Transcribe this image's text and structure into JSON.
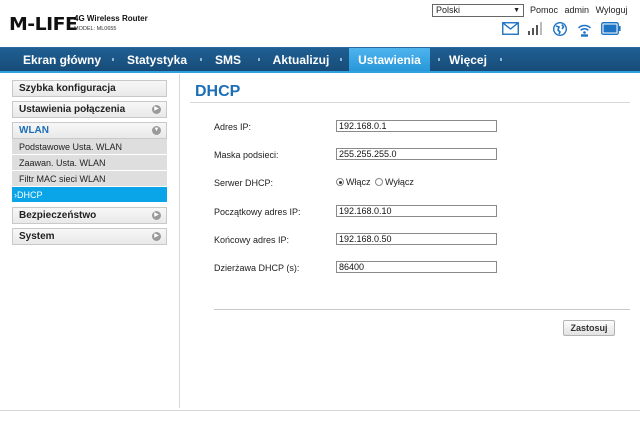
{
  "header": {
    "logo": "M-LIFE",
    "model_title": "4G Wireless Router",
    "model_sub": "MODEL: ML0655",
    "language": "Polski",
    "links": {
      "help": "Pomoc",
      "user": "admin",
      "logout": "Wyloguj"
    },
    "icons": [
      "envelope-icon",
      "signal-bars-icon",
      "globe-icon",
      "wifi-icon",
      "battery-icon"
    ]
  },
  "nav": {
    "items": [
      "Ekran główny",
      "Statystyka",
      "SMS",
      "Aktualizuj",
      "Ustawienia",
      "Więcej"
    ],
    "active": "Ustawienia"
  },
  "sidebar": {
    "quick": "Szybka konfiguracja",
    "connection": "Ustawienia połączenia",
    "wlan": "WLAN",
    "wlan_items": [
      "Podstawowe Usta. WLAN",
      "Zaawan. Usta. WLAN",
      "Filtr MAC sieci WLAN",
      "›DHCP"
    ],
    "security": "Bezpieczeństwo",
    "system": "System"
  },
  "main": {
    "title": "DHCP",
    "fields": {
      "ip_label": "Adres IP:",
      "ip_value": "192.168.0.1",
      "mask_label": "Maska podsieci:",
      "mask_value": "255.255.255.0",
      "dhcp_label": "Serwer DHCP:",
      "dhcp_on": "Włącz",
      "dhcp_off": "Wyłącz",
      "start_label": "Początkowy adres IP:",
      "start_value": "192.168.0.10",
      "end_label": "Końcowy adres IP:",
      "end_value": "192.168.0.50",
      "lease_label": "Dzierżawa DHCP (s):",
      "lease_value": "86400"
    },
    "apply": "Zastosuj"
  },
  "colors": {
    "nav_bg": "#1b5585",
    "nav_active": "#2ea3e3",
    "title_blue": "#1c6fb7",
    "sidebar_active": "#0aa4e8"
  }
}
